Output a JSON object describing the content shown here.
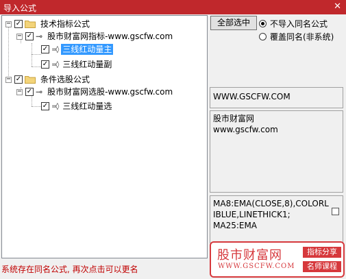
{
  "window": {
    "title": "导入公式",
    "close_glyph": "✕"
  },
  "tree": {
    "groups": [
      {
        "label": "技术指标公式",
        "checked": true,
        "children": [
          {
            "label": "股市财富网指标-www.gscfw.com",
            "checked": true,
            "children": [
              {
                "label": "三线红动量主",
                "checked": true,
                "selected": true
              },
              {
                "label": "三线红动量副",
                "checked": true,
                "selected": false
              }
            ]
          }
        ]
      },
      {
        "label": "条件选股公式",
        "checked": true,
        "children": [
          {
            "label": "股市财富网选股-www.gscfw.com",
            "checked": true,
            "children": [
              {
                "label": "三线红动量选",
                "checked": true,
                "selected": false
              }
            ]
          }
        ]
      }
    ],
    "expander_glyph": "−",
    "check_glyph": "✓",
    "icons": {
      "folder": "folder-icon",
      "key": "key-icon",
      "formula": "formula-file-icon"
    }
  },
  "controls": {
    "select_all_label": "全部选中",
    "radio_options": [
      {
        "label": "不导入同名公式",
        "selected": true
      },
      {
        "label": "覆盖同名(非系统)",
        "selected": false
      }
    ]
  },
  "info": {
    "url": "WWW.GSCFW.COM",
    "name_line1": "股市财富网",
    "name_line2": "www.gscfw.com",
    "code": "MA8:EMA(CLOSE,8),COLORLIBLUE,LINETHICK1;\nMA25:EMA"
  },
  "status": "系统存在同名公式, 再次点击可以更名",
  "ad": {
    "title": "股市财富网",
    "url": "WWW.GSCFW.COM",
    "tag1": "指标分享",
    "tag2": "名师课程",
    "brand_color": "#d6383c"
  },
  "colors": {
    "titlebar": "#c0282c",
    "selection": "#3399ff",
    "status_text": "#c00000"
  }
}
